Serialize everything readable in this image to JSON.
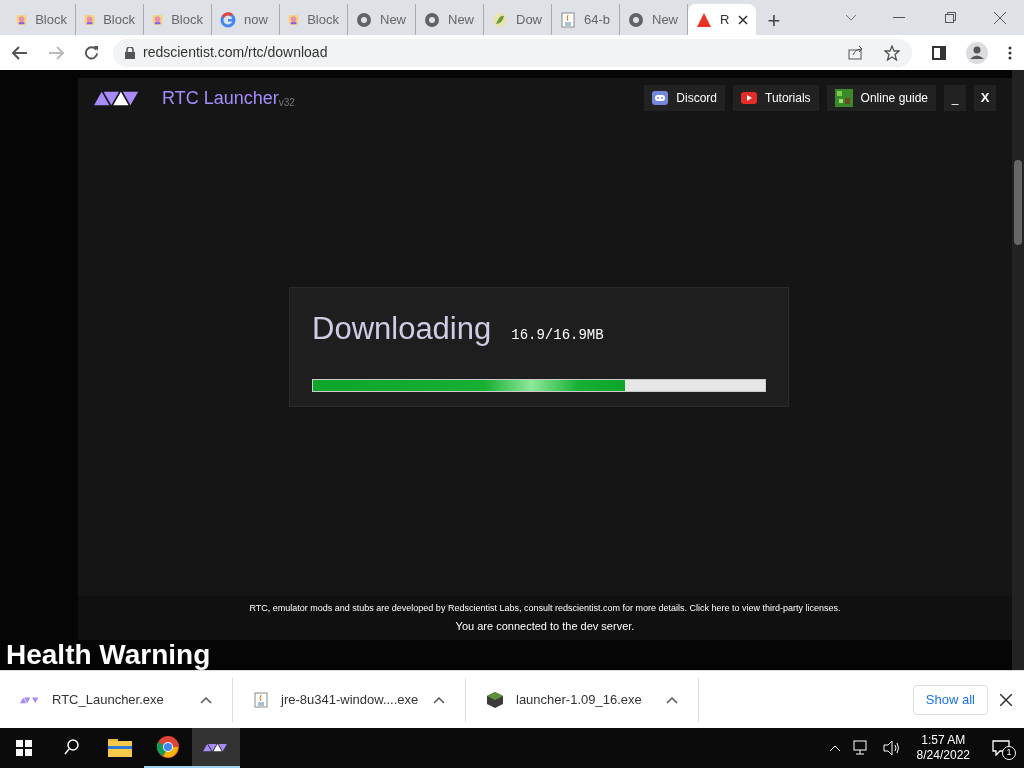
{
  "browser": {
    "tabs": [
      {
        "title": "Block",
        "kind": "avatar",
        "selected": false
      },
      {
        "title": "Block",
        "kind": "avatar",
        "selected": false
      },
      {
        "title": "Block",
        "kind": "avatar",
        "selected": false
      },
      {
        "title": "now",
        "kind": "google",
        "selected": false
      },
      {
        "title": "Block",
        "kind": "avatar",
        "selected": false
      },
      {
        "title": "New",
        "kind": "chrome",
        "selected": false
      },
      {
        "title": "New",
        "kind": "chrome",
        "selected": false
      },
      {
        "title": "Dow",
        "kind": "leaf",
        "selected": false
      },
      {
        "title": "64-b",
        "kind": "java",
        "selected": false
      },
      {
        "title": "New",
        "kind": "chrome",
        "selected": false
      },
      {
        "title": "R",
        "kind": "warning",
        "selected": true
      }
    ],
    "new_tab": "+",
    "address": "redscientist.com/rtc/download"
  },
  "launcher": {
    "title": "RTC Launcher",
    "version": "v32",
    "links": [
      {
        "label": "Discord",
        "kind": "discord"
      },
      {
        "label": "Tutorials",
        "kind": "youtube"
      },
      {
        "label": "Online guide",
        "kind": "guide"
      }
    ],
    "minimize": "_",
    "close": "X",
    "download": {
      "heading": "Downloading",
      "size": "16.9/16.9MB",
      "level": 0.69
    },
    "notice": "RTC, emulator mods and stubs are developed by Redscientist Labs, consult redscientist.com for more details. Click here to view third-party licenses.",
    "status": "You are connected to the dev server."
  },
  "page_heading": "Health Warning",
  "downloads": [
    {
      "name": "RTC_Launcher.exe",
      "kind": "rtc"
    },
    {
      "name": "jre-8u341-window....exe",
      "kind": "java"
    },
    {
      "name": "launcher-1.09_16.exe",
      "kind": "game"
    }
  ],
  "show_all": "Show all",
  "taskbar": {
    "apps": [
      {
        "kind": "search",
        "running": false,
        "focused": false
      },
      {
        "kind": "folder",
        "running": false,
        "focused": false
      },
      {
        "kind": "chrome",
        "running": true,
        "focused": false
      },
      {
        "kind": "rtc",
        "running": true,
        "focused": true
      }
    ],
    "time": "1:57 AM",
    "date": "8/24/2022",
    "notifications": "1"
  }
}
